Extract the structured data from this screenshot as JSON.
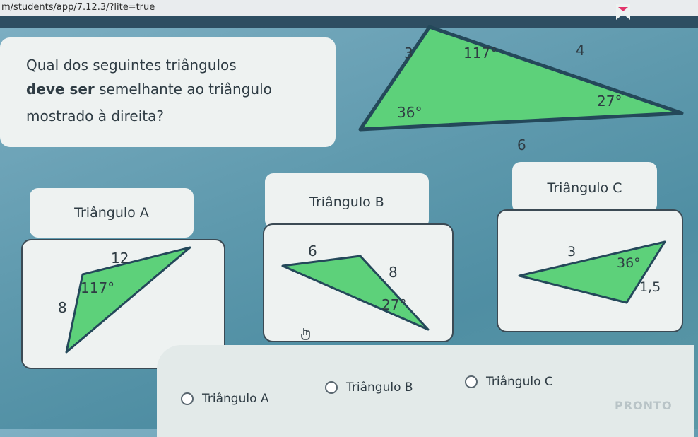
{
  "browser": {
    "url": "m/students/app/7.12.3/?lite=true"
  },
  "question": {
    "line1": "Qual dos seguintes triângulos",
    "line2_bold": "deve ser",
    "line2_rest": " semelhante ao triângulo",
    "line3": "mostrado à direita?"
  },
  "main_triangle": {
    "side_top_left": "3",
    "side_top_right": "4",
    "side_bottom": "6",
    "angle_top": "117°",
    "angle_left": "36°",
    "angle_right": "27°"
  },
  "options": {
    "a": {
      "title": "Triângulo A",
      "side_top": "12",
      "side_left": "8",
      "angle": "117°"
    },
    "b": {
      "title": "Triângulo B",
      "side_top": "6",
      "side_right": "8",
      "angle": "27°"
    },
    "c": {
      "title": "Triângulo C",
      "side_top": "3",
      "side_right": "1,5",
      "angle": "36°"
    }
  },
  "answers": {
    "choice_a": "Triângulo A",
    "choice_b": "Triângulo B",
    "choice_c": "Triângulo C",
    "submit": "PRONTO"
  },
  "colors": {
    "triangle_fill": "#5dd17a",
    "triangle_stroke": "#24485a",
    "card_bg": "#eef2f1",
    "accent_bookmark": "#e2356b"
  },
  "icons": {
    "bookmark": "bookmark-icon",
    "cursor": "hand-cursor-icon"
  }
}
